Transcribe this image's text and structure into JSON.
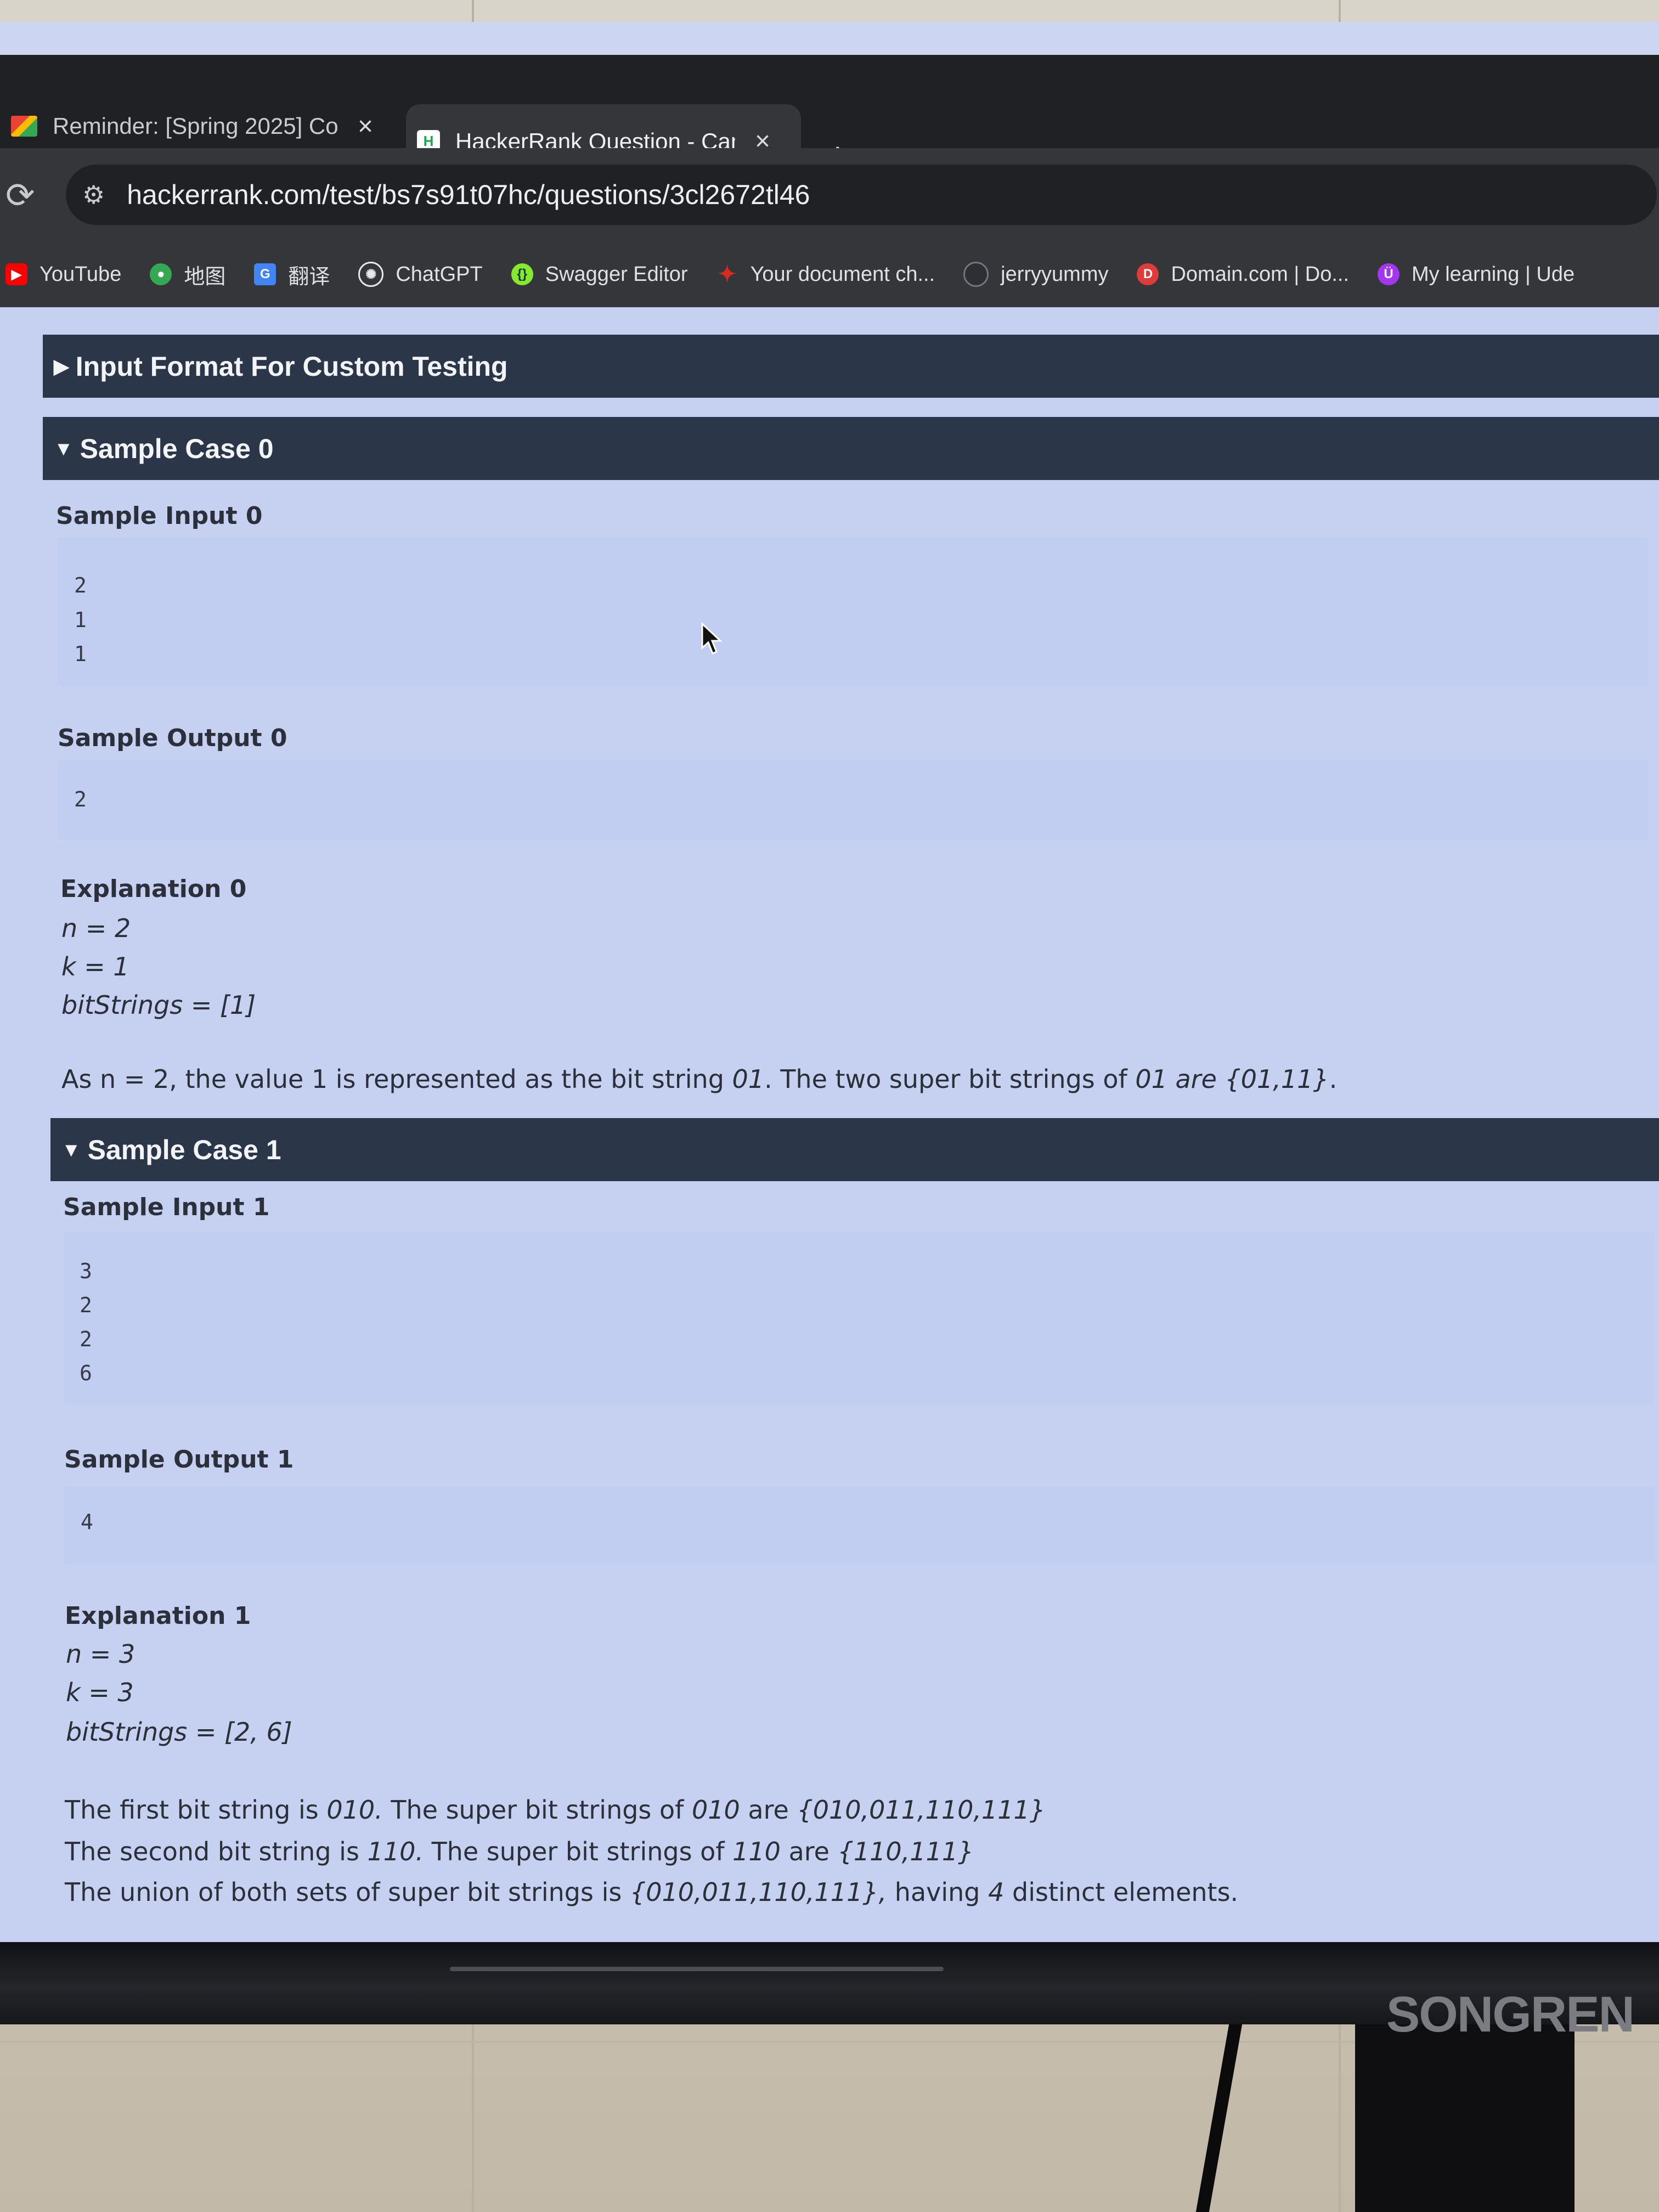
{
  "browser": {
    "tabs": [
      {
        "title": "Reminder: [Spring 2025] Co",
        "icon": "gmail-icon",
        "active": false
      },
      {
        "title": "HackerRank Question - Can y",
        "icon": "hackerrank-icon",
        "active": true
      }
    ],
    "new_tab_glyph": "+",
    "close_glyph": "×",
    "url": "hackerrank.com/test/bs7s91t07hc/questions/3cl2672tl46",
    "bookmarks": [
      {
        "label": "YouTube",
        "icon": "youtube-icon",
        "color": "#ff0000"
      },
      {
        "label": "地图",
        "icon": "maps-icon",
        "color": "#34a853"
      },
      {
        "label": "翻译",
        "icon": "translate-icon",
        "color": "#4285f4"
      },
      {
        "label": "ChatGPT",
        "icon": "chatgpt-icon",
        "color": "#e8e8e8"
      },
      {
        "label": "Swagger Editor",
        "icon": "swagger-icon",
        "color": "#85ea2d"
      },
      {
        "label": "Your document ch...",
        "icon": "maple-leaf-icon",
        "color": "#d52b1e"
      },
      {
        "label": "jerryyummy",
        "icon": "github-icon",
        "color": "#6e7681"
      },
      {
        "label": "Domain.com | Do...",
        "icon": "domain-icon",
        "color": "#e03b3b"
      },
      {
        "label": "My learning | Ude",
        "icon": "udemy-icon",
        "color": "#a435f0"
      }
    ]
  },
  "sections": {
    "input_format": {
      "title": "Input Format For Custom Testing",
      "expanded": false
    },
    "case0": {
      "title": "Sample Case 0",
      "input_label": "Sample Input 0",
      "input_lines": [
        "2",
        "1",
        "1"
      ],
      "output_label": "Sample Output 0",
      "output_lines": [
        "2"
      ],
      "explanation_label": "Explanation 0",
      "vars": [
        "n = 2",
        "k = 1",
        "bitStrings = [1]"
      ],
      "sentence": {
        "p1": "As n = 2, the value 1 is represented as the bit string ",
        "i1": "01",
        "p2": ". The two super bit strings of ",
        "i2": "01 are {01,11}",
        "p3": "."
      }
    },
    "case1": {
      "title": "Sample Case 1",
      "input_label": "Sample Input 1",
      "input_lines": [
        "3",
        "2",
        "2",
        "6"
      ],
      "output_label": "Sample Output 1",
      "output_lines": [
        "4"
      ],
      "explanation_label": "Explanation 1",
      "vars": [
        "n = 3",
        "k = 3",
        "bitStrings = [2, 6]"
      ],
      "line1": {
        "p1": "The first bit string is ",
        "i1": "010.",
        "p2": " The super bit strings of ",
        "i2": "010",
        "p3": " are ",
        "i3": "{010,011,110,111}"
      },
      "line2": {
        "p1": "The second bit string is ",
        "i1": "110.",
        "p2": " The super bit strings of ",
        "i2": "110",
        "p3": " are ",
        "i3": "{110,111}"
      },
      "line3": {
        "p1": "The union of both sets of super bit strings is ",
        "i1": "{010,011,110,111},",
        "p2": " having ",
        "i2": "4",
        "p3": " distinct elements."
      }
    }
  },
  "monitor": {
    "brand": "SONGREN"
  },
  "colors": {
    "section_bar": "#2b3649",
    "page_bg": "#c6d0f0",
    "chrome_dark": "#202124",
    "chrome_mid": "#35363a"
  }
}
